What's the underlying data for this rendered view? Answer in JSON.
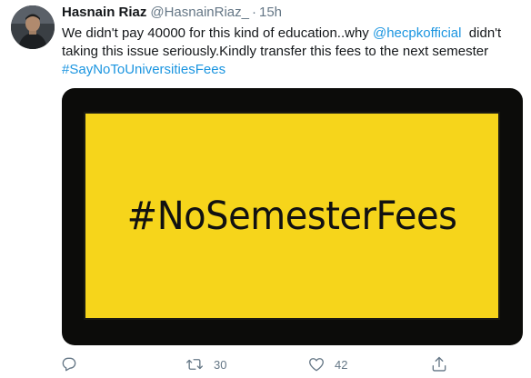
{
  "tweet": {
    "author_name": "Hasnain Riaz",
    "author_handle": "@HasnainRiaz_",
    "separator": "·",
    "time": "15h",
    "text_part1": "We didn't pay 40000 for this kind of education..why ",
    "mention": "@hecpkofficial",
    "text_part2": "  didn't",
    "text_line2": "taking this issue seriously.Kindly transfer this fees to the next semester",
    "hashtag": "#SayNoToUniversitiesFees",
    "image_text": "#NoSemesterFees"
  },
  "actions": {
    "reply_icon": "reply-icon",
    "retweet_icon": "retweet-icon",
    "retweet_count": "30",
    "like_icon": "heart-icon",
    "like_count": "42",
    "share_icon": "share-icon"
  },
  "colors": {
    "link": "#1b95e0",
    "muted": "#657786",
    "image_yellow": "#f6d51b",
    "image_frame": "#0c0c0a"
  }
}
